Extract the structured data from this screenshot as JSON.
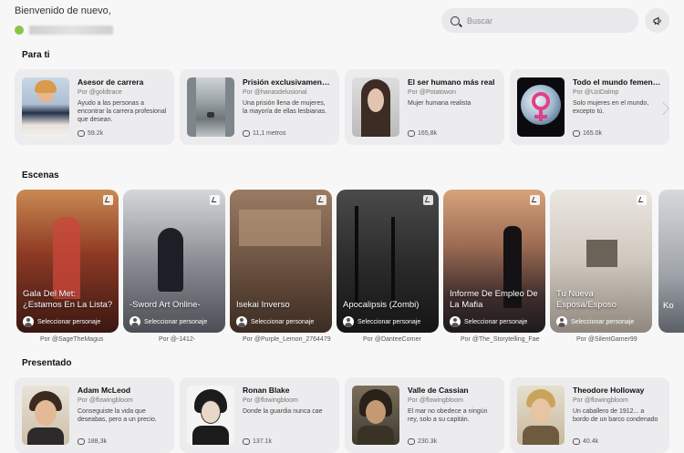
{
  "header": {
    "welcome": "Bienvenido de nuevo,"
  },
  "search": {
    "placeholder": "Buscar"
  },
  "colors": {
    "background": "#f7f7f8",
    "card": "#ececee",
    "accent": "#8ac34a"
  },
  "sections": {
    "for_you": "Para ti",
    "scenes": "Escenas",
    "featured": "Presentado"
  },
  "for_you": [
    {
      "title": "Asesor de carrera",
      "author": "Por @goldtrace",
      "desc": "Ayudo a las personas a encontrar la carrera profesional que desean.",
      "count": "59.2k",
      "icon": "career-advisor-portrait"
    },
    {
      "title": "Prisión exclusivamente...",
      "author": "Por @hanasdelusional",
      "desc": "Una prisión llena de mujeres, la mayoría de ellas lesbianas.",
      "count": "11,1 metros",
      "icon": "prison-hall"
    },
    {
      "title": "El ser humano más real",
      "author": "Por @Potatowon",
      "desc": "Mujer humana realista",
      "count": "165,8k",
      "icon": "woman-portrait"
    },
    {
      "title": "Todo el mundo femenino",
      "author": "Por @UziDalmp",
      "desc": "Solo mujeres en el mundo, excepto tú.",
      "count": "165.0k",
      "icon": "female-symbol-globe"
    }
  ],
  "scenes": [
    {
      "title": "Gala Del Met: ¿Estamos En La Lista?",
      "select": "Seleccionar personaje",
      "author": "Por @SageTheMagus"
    },
    {
      "title": "-Sword Art Online-",
      "select": "Seleccionar personaje",
      "author": "Por @-1412-"
    },
    {
      "title": "Isekai Inverso",
      "select": "Seleccionar personaje",
      "author": "Por @Purple_Lemon_2764479"
    },
    {
      "title": "Apocalipsis (Zombi)",
      "select": "Seleccionar personaje",
      "author": "Por @DanteeCorner"
    },
    {
      "title": "Informe De Empleo De La Mafia",
      "select": "Seleccionar personaje",
      "author": "Por @The_Storytelling_Fae"
    },
    {
      "title": "Tu Nueva Esposa/Esposo",
      "select": "Seleccionar personaje",
      "author": "Por @SilentGamer99"
    }
  ],
  "scene_partial": "Ko",
  "featured": [
    {
      "title": "Adam McLeod",
      "author": "Por @flowingbloom",
      "desc": "Conseguiste la vida que deseabas, pero a un precio.",
      "count": "188,3k"
    },
    {
      "title": "Ronan Blake",
      "author": "Por @flowingbloom",
      "desc": "Donde la guardia nunca cae",
      "count": "137.1k"
    },
    {
      "title": "Valle de Cassian",
      "author": "Por @flowingbloom",
      "desc": "El mar no obedece a ningún rey, solo a su capitán.",
      "count": "230.3k"
    },
    {
      "title": "Theodore Holloway",
      "author": "Por @flowingbloom",
      "desc": "Un caballero de 1912... a bordo de un barco condenado",
      "count": "40.4k"
    }
  ]
}
